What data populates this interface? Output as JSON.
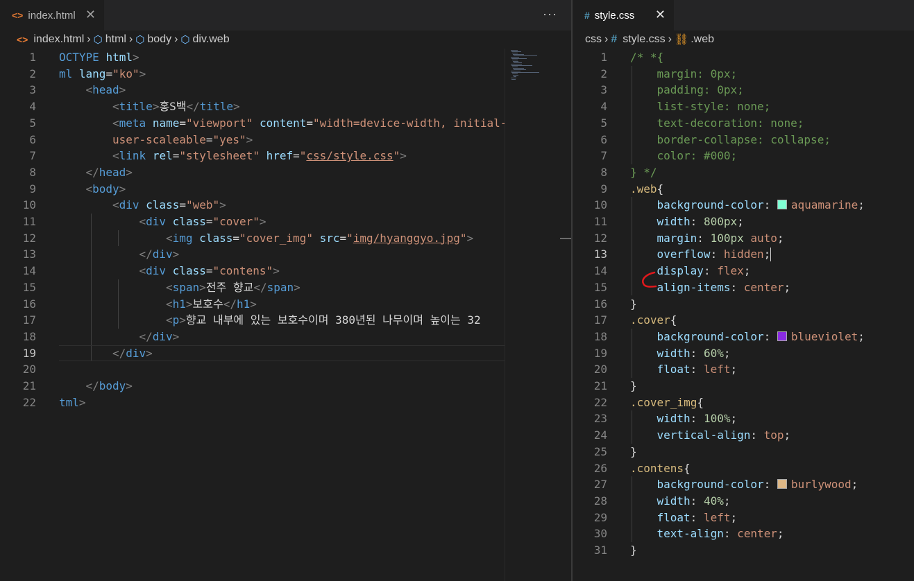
{
  "left_editor": {
    "tab": {
      "icon": "html-file-icon",
      "title": "index.html",
      "close": "✕"
    },
    "more_actions": "···",
    "breadcrumb": [
      "index.html",
      "html",
      "body",
      "div.web"
    ],
    "active_line": 19,
    "lines": [
      {
        "n": "1",
        "indent": 0,
        "tokens": [
          [
            "t-tag",
            "OCTYPE "
          ],
          [
            "t-attr",
            "html"
          ],
          [
            "t-punct",
            ">"
          ]
        ]
      },
      {
        "n": "2",
        "indent": 0,
        "tokens": [
          [
            "t-tag",
            "ml "
          ],
          [
            "t-attr",
            "lang"
          ],
          [
            "t-text",
            "="
          ],
          [
            "t-str",
            "\"ko\""
          ],
          [
            "t-punct",
            ">"
          ]
        ]
      },
      {
        "n": "3",
        "indent": 1,
        "tokens": [
          [
            "t-punct",
            "<"
          ],
          [
            "t-tag",
            "head"
          ],
          [
            "t-punct",
            ">"
          ]
        ]
      },
      {
        "n": "4",
        "indent": 2,
        "tokens": [
          [
            "t-punct",
            "<"
          ],
          [
            "t-tag",
            "title"
          ],
          [
            "t-punct",
            ">"
          ],
          [
            "t-text",
            "홍S백"
          ],
          [
            "t-punct",
            "</"
          ],
          [
            "t-tag",
            "title"
          ],
          [
            "t-punct",
            ">"
          ]
        ]
      },
      {
        "n": "5",
        "indent": 2,
        "tokens": [
          [
            "t-punct",
            "<"
          ],
          [
            "t-tag",
            "meta "
          ],
          [
            "t-attr",
            "name"
          ],
          [
            "t-text",
            "="
          ],
          [
            "t-str",
            "\"viewport\" "
          ],
          [
            "t-attr",
            "content"
          ],
          [
            "t-text",
            "="
          ],
          [
            "t-str",
            "\"width=device-width, initial-sca"
          ]
        ]
      },
      {
        "n": "6",
        "indent": 2,
        "tokens": [
          [
            "t-str",
            "user-scaleable"
          ],
          [
            "t-text",
            "="
          ],
          [
            "t-str",
            "\"yes\""
          ],
          [
            "t-punct",
            ">"
          ]
        ]
      },
      {
        "n": "7",
        "indent": 2,
        "tokens": [
          [
            "t-punct",
            "<"
          ],
          [
            "t-tag",
            "link "
          ],
          [
            "t-attr",
            "rel"
          ],
          [
            "t-text",
            "="
          ],
          [
            "t-str",
            "\"stylesheet\" "
          ],
          [
            "t-attr",
            "href"
          ],
          [
            "t-text",
            "="
          ],
          [
            "t-str",
            "\""
          ],
          [
            "t-link",
            "css/style.css"
          ],
          [
            "t-str",
            "\""
          ],
          [
            "t-punct",
            ">"
          ]
        ]
      },
      {
        "n": "8",
        "indent": 1,
        "tokens": [
          [
            "t-punct",
            "</"
          ],
          [
            "t-tag",
            "head"
          ],
          [
            "t-punct",
            ">"
          ]
        ]
      },
      {
        "n": "9",
        "indent": 1,
        "tokens": [
          [
            "t-punct",
            "<"
          ],
          [
            "t-tag",
            "body"
          ],
          [
            "t-punct",
            ">"
          ]
        ]
      },
      {
        "n": "10",
        "indent": 2,
        "tokens": [
          [
            "t-punct",
            "<"
          ],
          [
            "t-tag",
            "div "
          ],
          [
            "t-attr",
            "class"
          ],
          [
            "t-text",
            "="
          ],
          [
            "t-str",
            "\"web\""
          ],
          [
            "t-punct",
            ">"
          ]
        ]
      },
      {
        "n": "11",
        "indent": 3,
        "tokens": [
          [
            "t-punct",
            "<"
          ],
          [
            "t-tag",
            "div "
          ],
          [
            "t-attr",
            "class"
          ],
          [
            "t-text",
            "="
          ],
          [
            "t-str",
            "\"cover\""
          ],
          [
            "t-punct",
            ">"
          ]
        ]
      },
      {
        "n": "12",
        "indent": 4,
        "tokens": [
          [
            "t-punct",
            "<"
          ],
          [
            "t-tag",
            "img "
          ],
          [
            "t-attr",
            "class"
          ],
          [
            "t-text",
            "="
          ],
          [
            "t-str",
            "\"cover_img\" "
          ],
          [
            "t-attr",
            "src"
          ],
          [
            "t-text",
            "="
          ],
          [
            "t-str",
            "\""
          ],
          [
            "t-link",
            "img/hyanggyo.jpg"
          ],
          [
            "t-str",
            "\""
          ],
          [
            "t-punct",
            ">"
          ]
        ]
      },
      {
        "n": "13",
        "indent": 3,
        "tokens": [
          [
            "t-punct",
            "</"
          ],
          [
            "t-tag",
            "div"
          ],
          [
            "t-punct",
            ">"
          ]
        ]
      },
      {
        "n": "14",
        "indent": 3,
        "tokens": [
          [
            "t-punct",
            "<"
          ],
          [
            "t-tag",
            "div "
          ],
          [
            "t-attr",
            "class"
          ],
          [
            "t-text",
            "="
          ],
          [
            "t-str",
            "\"contens\""
          ],
          [
            "t-punct",
            ">"
          ]
        ]
      },
      {
        "n": "15",
        "indent": 4,
        "tokens": [
          [
            "t-punct",
            "<"
          ],
          [
            "t-tag",
            "span"
          ],
          [
            "t-punct",
            ">"
          ],
          [
            "t-text",
            "전주 향교"
          ],
          [
            "t-punct",
            "</"
          ],
          [
            "t-tag",
            "span"
          ],
          [
            "t-punct",
            ">"
          ]
        ]
      },
      {
        "n": "16",
        "indent": 4,
        "tokens": [
          [
            "t-punct",
            "<"
          ],
          [
            "t-tag",
            "h1"
          ],
          [
            "t-punct",
            ">"
          ],
          [
            "t-text",
            "보호수"
          ],
          [
            "t-punct",
            "</"
          ],
          [
            "t-tag",
            "h1"
          ],
          [
            "t-punct",
            ">"
          ]
        ]
      },
      {
        "n": "17",
        "indent": 4,
        "tokens": [
          [
            "t-punct",
            "<"
          ],
          [
            "t-tag",
            "p"
          ],
          [
            "t-punct",
            ">"
          ],
          [
            "t-text",
            "향교 내부에 있는 보호수이며 380년된 나무이며 높이는 32"
          ]
        ]
      },
      {
        "n": "18",
        "indent": 3,
        "tokens": [
          [
            "t-punct",
            "</"
          ],
          [
            "t-tag",
            "div"
          ],
          [
            "t-punct",
            ">"
          ]
        ]
      },
      {
        "n": "19",
        "indent": 2,
        "tokens": [
          [
            "t-punct",
            "</"
          ],
          [
            "t-tag",
            "div"
          ],
          [
            "t-punct",
            ">"
          ]
        ]
      },
      {
        "n": "20",
        "indent": 0,
        "tokens": []
      },
      {
        "n": "21",
        "indent": 1,
        "tokens": [
          [
            "t-punct",
            "</"
          ],
          [
            "t-tag",
            "body"
          ],
          [
            "t-punct",
            ">"
          ]
        ]
      },
      {
        "n": "22",
        "indent": 0,
        "tokens": [
          [
            "t-tag",
            "tml"
          ],
          [
            "t-punct",
            ">"
          ]
        ]
      }
    ]
  },
  "right_editor": {
    "tab": {
      "icon": "css-file-icon",
      "title": "style.css",
      "close": "✕"
    },
    "breadcrumb": [
      "css",
      "style.css",
      ".web"
    ],
    "active_line": 13,
    "colors": {
      "aquamarine": "#7fffd4",
      "blueviolet": "#8a2be2",
      "burlywood": "#deb887",
      "annotation": "#e0181c"
    },
    "lines": [
      {
        "n": "1",
        "indent": 0,
        "tokens": [
          [
            "t-cmt",
            "/* *{"
          ]
        ]
      },
      {
        "n": "2",
        "indent": 1,
        "tokens": [
          [
            "t-cmt",
            "margin: 0px;"
          ]
        ]
      },
      {
        "n": "3",
        "indent": 1,
        "tokens": [
          [
            "t-cmt",
            "padding: 0px;"
          ]
        ]
      },
      {
        "n": "4",
        "indent": 1,
        "tokens": [
          [
            "t-cmt",
            "list-style: none;"
          ]
        ]
      },
      {
        "n": "5",
        "indent": 1,
        "tokens": [
          [
            "t-cmt",
            "text-decoration: none;"
          ]
        ]
      },
      {
        "n": "6",
        "indent": 1,
        "tokens": [
          [
            "t-cmt",
            "border-collapse: collapse;"
          ]
        ]
      },
      {
        "n": "7",
        "indent": 1,
        "tokens": [
          [
            "t-cmt",
            "color: #000;"
          ]
        ]
      },
      {
        "n": "8",
        "indent": 0,
        "tokens": [
          [
            "t-cmt",
            "} */"
          ]
        ]
      },
      {
        "n": "9",
        "indent": 0,
        "tokens": [
          [
            "t-sel",
            ".web"
          ],
          [
            "t-plain",
            "{"
          ]
        ]
      },
      {
        "n": "10",
        "indent": 1,
        "tokens": [
          [
            "t-prop",
            "background-color"
          ],
          [
            "t-plain",
            ": "
          ],
          [
            "swatch",
            "#7fffd4"
          ],
          [
            "t-val",
            "aquamarine"
          ],
          [
            "t-plain",
            ";"
          ]
        ]
      },
      {
        "n": "11",
        "indent": 1,
        "tokens": [
          [
            "t-prop",
            "width"
          ],
          [
            "t-plain",
            ": "
          ],
          [
            "t-num",
            "800px"
          ],
          [
            "t-plain",
            ";"
          ]
        ]
      },
      {
        "n": "12",
        "indent": 1,
        "tokens": [
          [
            "t-prop",
            "margin"
          ],
          [
            "t-plain",
            ": "
          ],
          [
            "t-num",
            "100px"
          ],
          [
            "t-plain",
            " "
          ],
          [
            "t-val",
            "auto"
          ],
          [
            "t-plain",
            ";"
          ]
        ]
      },
      {
        "n": "13",
        "indent": 1,
        "tokens": [
          [
            "t-prop",
            "overflow"
          ],
          [
            "t-plain",
            ": "
          ],
          [
            "t-val",
            "hidden"
          ],
          [
            "t-plain",
            ";"
          ]
        ]
      },
      {
        "n": "14",
        "indent": 1,
        "tokens": [
          [
            "t-prop",
            "display"
          ],
          [
            "t-plain",
            ": "
          ],
          [
            "t-val",
            "flex"
          ],
          [
            "t-plain",
            ";"
          ]
        ]
      },
      {
        "n": "15",
        "indent": 1,
        "tokens": [
          [
            "t-prop",
            "align-items"
          ],
          [
            "t-plain",
            ": "
          ],
          [
            "t-val",
            "center"
          ],
          [
            "t-plain",
            ";"
          ]
        ]
      },
      {
        "n": "16",
        "indent": 0,
        "tokens": [
          [
            "t-plain",
            "}"
          ]
        ]
      },
      {
        "n": "17",
        "indent": 0,
        "tokens": [
          [
            "t-sel",
            ".cover"
          ],
          [
            "t-plain",
            "{"
          ]
        ]
      },
      {
        "n": "18",
        "indent": 1,
        "tokens": [
          [
            "t-prop",
            "background-color"
          ],
          [
            "t-plain",
            ": "
          ],
          [
            "swatch",
            "#8a2be2"
          ],
          [
            "t-val",
            "blueviolet"
          ],
          [
            "t-plain",
            ";"
          ]
        ]
      },
      {
        "n": "19",
        "indent": 1,
        "tokens": [
          [
            "t-prop",
            "width"
          ],
          [
            "t-plain",
            ": "
          ],
          [
            "t-num",
            "60%"
          ],
          [
            "t-plain",
            ";"
          ]
        ]
      },
      {
        "n": "20",
        "indent": 1,
        "tokens": [
          [
            "t-prop",
            "float"
          ],
          [
            "t-plain",
            ": "
          ],
          [
            "t-val",
            "left"
          ],
          [
            "t-plain",
            ";"
          ]
        ]
      },
      {
        "n": "21",
        "indent": 0,
        "tokens": [
          [
            "t-plain",
            "}"
          ]
        ]
      },
      {
        "n": "22",
        "indent": 0,
        "tokens": [
          [
            "t-sel",
            ".cover_img"
          ],
          [
            "t-plain",
            "{"
          ]
        ]
      },
      {
        "n": "23",
        "indent": 1,
        "tokens": [
          [
            "t-prop",
            "width"
          ],
          [
            "t-plain",
            ": "
          ],
          [
            "t-num",
            "100%"
          ],
          [
            "t-plain",
            ";"
          ]
        ]
      },
      {
        "n": "24",
        "indent": 1,
        "tokens": [
          [
            "t-prop",
            "vertical-align"
          ],
          [
            "t-plain",
            ": "
          ],
          [
            "t-val",
            "top"
          ],
          [
            "t-plain",
            ";"
          ]
        ]
      },
      {
        "n": "25",
        "indent": 0,
        "tokens": [
          [
            "t-plain",
            "}"
          ]
        ]
      },
      {
        "n": "26",
        "indent": 0,
        "tokens": [
          [
            "t-sel",
            ".contens"
          ],
          [
            "t-plain",
            "{"
          ]
        ]
      },
      {
        "n": "27",
        "indent": 1,
        "tokens": [
          [
            "t-prop",
            "background-color"
          ],
          [
            "t-plain",
            ": "
          ],
          [
            "swatch",
            "#deb887"
          ],
          [
            "t-val",
            "burlywood"
          ],
          [
            "t-plain",
            ";"
          ]
        ]
      },
      {
        "n": "28",
        "indent": 1,
        "tokens": [
          [
            "t-prop",
            "width"
          ],
          [
            "t-plain",
            ": "
          ],
          [
            "t-num",
            "40%"
          ],
          [
            "t-plain",
            ";"
          ]
        ]
      },
      {
        "n": "29",
        "indent": 1,
        "tokens": [
          [
            "t-prop",
            "float"
          ],
          [
            "t-plain",
            ": "
          ],
          [
            "t-val",
            "left"
          ],
          [
            "t-plain",
            ";"
          ]
        ]
      },
      {
        "n": "30",
        "indent": 1,
        "tokens": [
          [
            "t-prop",
            "text-align"
          ],
          [
            "t-plain",
            ": "
          ],
          [
            "t-val",
            "center"
          ],
          [
            "t-plain",
            ";"
          ]
        ]
      },
      {
        "n": "31",
        "indent": 0,
        "tokens": [
          [
            "t-plain",
            "}"
          ]
        ]
      }
    ]
  }
}
